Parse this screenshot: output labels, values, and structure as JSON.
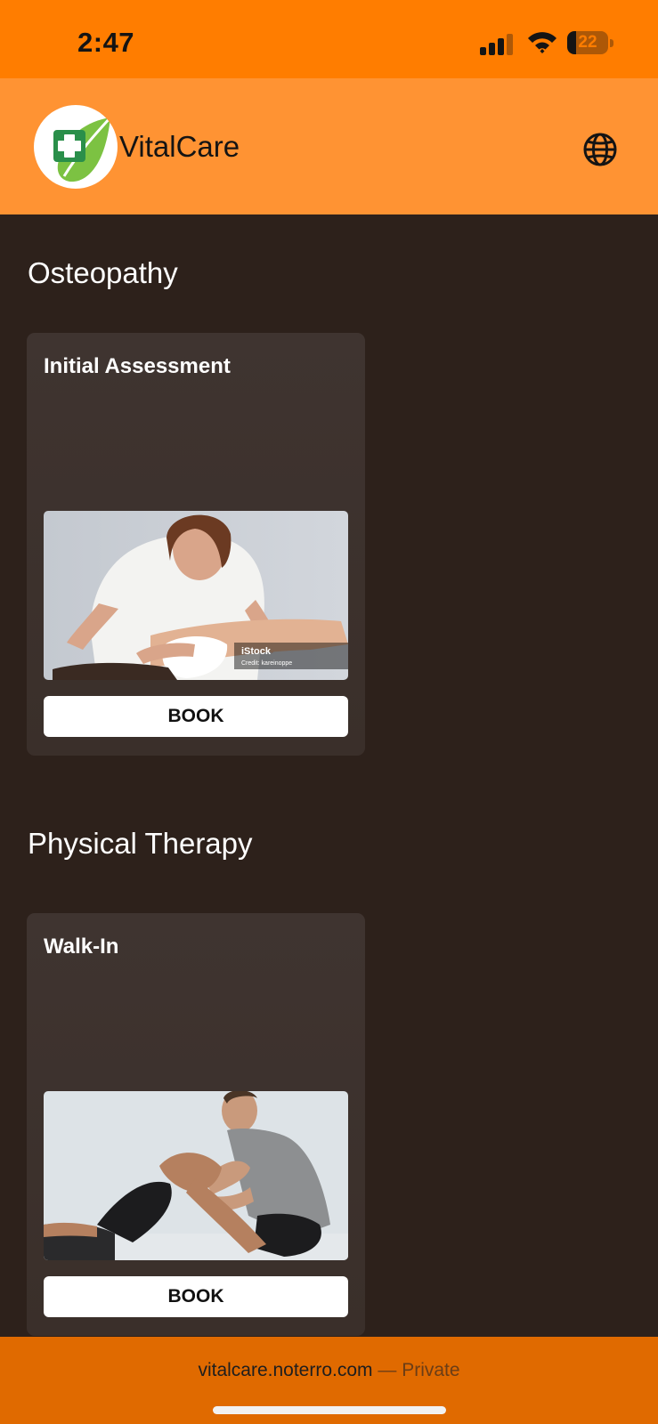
{
  "status_bar": {
    "time": "2:47",
    "battery": "22",
    "battery_level": 0.22
  },
  "header": {
    "brand": "VitalCare"
  },
  "sections": [
    {
      "title": "Osteopathy",
      "card": {
        "title": "Initial Assessment",
        "image_watermark": "iStock",
        "image_credit": "Credit: kareinoppe",
        "button": "BOOK"
      }
    },
    {
      "title": "Physical Therapy",
      "card": {
        "title": "Walk-In",
        "button": "BOOK"
      }
    }
  ],
  "footer": {
    "domain": "vitalcare.noterro.com",
    "separator": " — ",
    "privacy": "Private"
  },
  "colors": {
    "status_bar": "#ff7d00",
    "header": "#ff9333",
    "background": "#2d211b",
    "card": "#3d322d",
    "footer": "#e06a00"
  }
}
